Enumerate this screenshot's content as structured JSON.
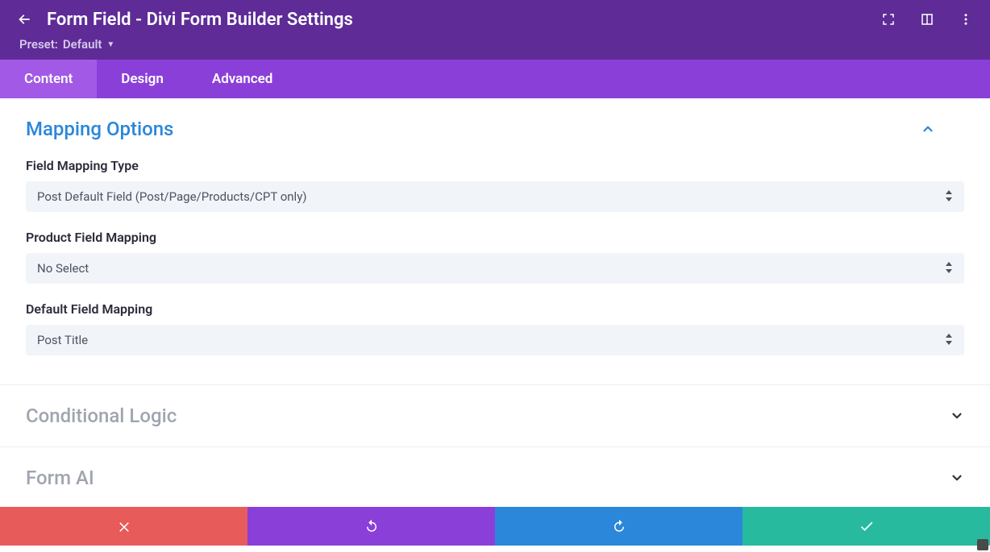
{
  "header": {
    "title": "Form Field - Divi Form Builder Settings",
    "preset_label": "Preset:",
    "preset_value": "Default"
  },
  "tabs": [
    {
      "label": "Content",
      "active": true
    },
    {
      "label": "Design",
      "active": false
    },
    {
      "label": "Advanced",
      "active": false
    }
  ],
  "sections": {
    "mapping": {
      "title": "Mapping Options",
      "fields": {
        "field_mapping_type": {
          "label": "Field Mapping Type",
          "value": "Post Default Field (Post/Page/Products/CPT only)"
        },
        "product_field_mapping": {
          "label": "Product Field Mapping",
          "value": "No Select"
        },
        "default_field_mapping": {
          "label": "Default Field Mapping",
          "value": "Post Title"
        }
      }
    },
    "conditional_logic": {
      "title": "Conditional Logic"
    },
    "form_ai": {
      "title": "Form AI"
    }
  }
}
